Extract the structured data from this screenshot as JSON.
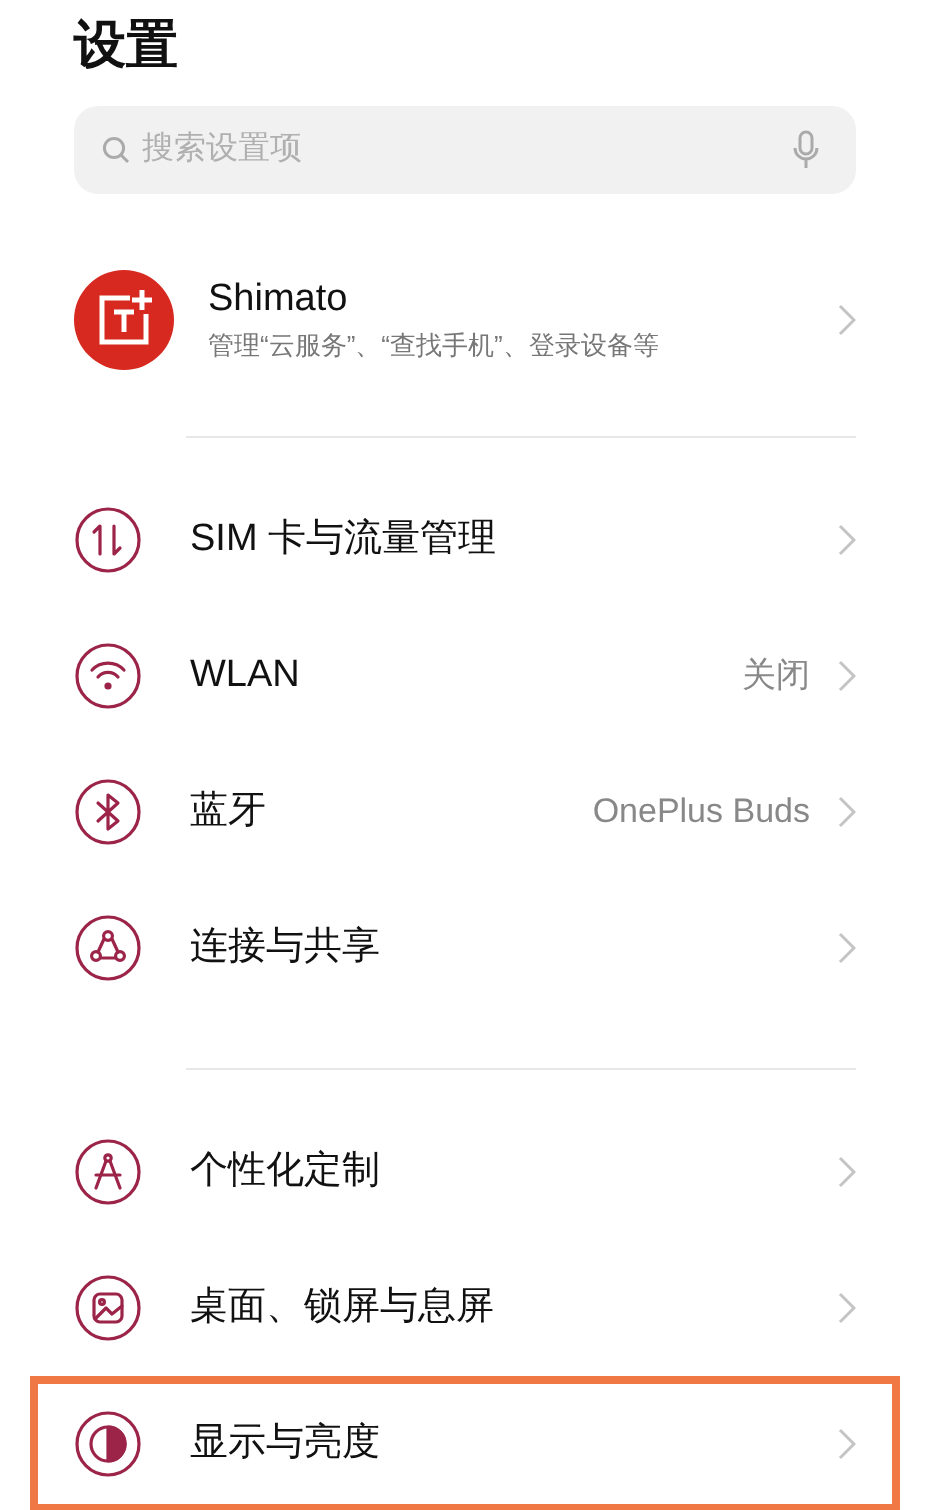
{
  "title": "设置",
  "search": {
    "placeholder": "搜索设置项"
  },
  "account": {
    "name": "Shimato",
    "subtitle": "管理“云服务”、“查找手机”、登录设备等"
  },
  "sections": [
    {
      "items": [
        {
          "label": "SIM 卡与流量管理",
          "highlighted": false
        },
        {
          "label": "WLAN",
          "value": "关闭",
          "highlighted": false
        },
        {
          "label": "蓝牙",
          "value": "OnePlus Buds",
          "highlighted": false
        },
        {
          "label": "连接与共享",
          "highlighted": false
        }
      ]
    },
    {
      "items": [
        {
          "label": "个性化定制",
          "highlighted": false
        },
        {
          "label": "桌面、锁屏与息屏",
          "highlighted": false
        },
        {
          "label": "显示与亮度",
          "highlighted": true
        }
      ]
    }
  ]
}
